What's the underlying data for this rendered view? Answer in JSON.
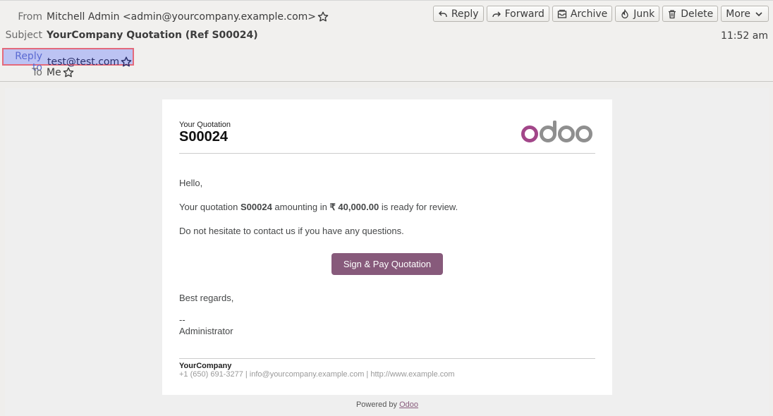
{
  "header": {
    "from_label": "From",
    "from_value": "Mitchell Admin <admin@yourcompany.example.com>",
    "subject_label": "Subject",
    "subject_value": "YourCompany Quotation (Ref S00024)",
    "reply_to_label": "Reply to",
    "reply_to_value": "test@test.com",
    "to_label": "To",
    "to_value": "Me",
    "time": "11:52 am"
  },
  "toolbar": {
    "reply": "Reply",
    "forward": "Forward",
    "archive": "Archive",
    "junk": "Junk",
    "delete": "Delete",
    "more": "More"
  },
  "email": {
    "your_quotation": "Your Quotation",
    "quotation_number": "S00024",
    "greeting": "Hello,",
    "line1_pre": "Your quotation ",
    "line1_ref": "S00024",
    "line1_mid": " amounting in ",
    "line1_amount": "₹ 40,000.00",
    "line1_post": " is ready for review.",
    "line2": "Do not hesitate to contact us if you have any questions.",
    "cta": "Sign & Pay Quotation",
    "regards": "Best regards,",
    "sig_dash": "--",
    "sig_name": "Administrator",
    "company": "YourCompany",
    "company_info": "+1 (650) 691-3277 | info@yourcompany.example.com | http://www.example.com",
    "powered_pre": "Powered by ",
    "powered_link": "Odoo",
    "logo_text": "odoo"
  },
  "colors": {
    "odoo_purple": "#875a7b",
    "highlight_bg": "#bcc3f3",
    "highlight_border": "#e46a7b"
  }
}
